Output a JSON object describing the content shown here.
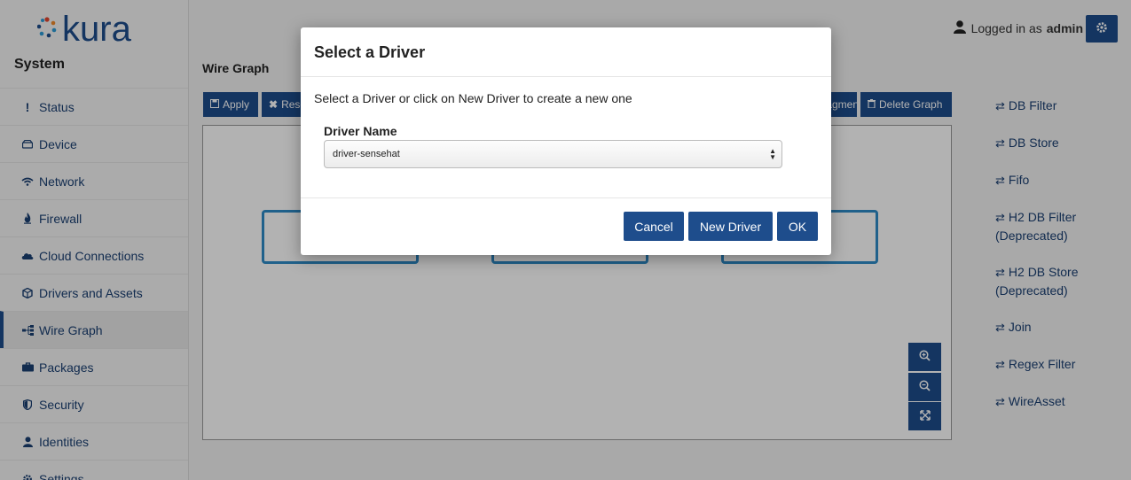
{
  "brand": {
    "logo_text": "kura"
  },
  "sidebar": {
    "section_title": "System",
    "items": [
      {
        "label": "Status",
        "icon": "exclamation-icon"
      },
      {
        "label": "Device",
        "icon": "hdd-icon"
      },
      {
        "label": "Network",
        "icon": "wifi-icon"
      },
      {
        "label": "Firewall",
        "icon": "fire-icon"
      },
      {
        "label": "Cloud Connections",
        "icon": "cloud-icon"
      },
      {
        "label": "Drivers and Assets",
        "icon": "cube-icon"
      },
      {
        "label": "Wire Graph",
        "icon": "sitemap-icon",
        "active": true
      },
      {
        "label": "Packages",
        "icon": "briefcase-icon"
      },
      {
        "label": "Security",
        "icon": "shield-icon"
      },
      {
        "label": "Identities",
        "icon": "user-icon"
      },
      {
        "label": "Settings",
        "icon": "gear-icon"
      }
    ]
  },
  "header": {
    "logged_in_prefix": "Logged in as",
    "username": "admin"
  },
  "main": {
    "title": "Wire Graph",
    "toolbar": {
      "apply": "Apply",
      "reset": "Reset",
      "fragment": "Fragment",
      "delete_graph": "Delete Graph"
    }
  },
  "components": [
    {
      "label": "DB Filter"
    },
    {
      "label": "DB Store"
    },
    {
      "label": "Fifo"
    },
    {
      "label": "H2 DB Filter",
      "sub": "(Deprecated)"
    },
    {
      "label": "H2 DB Store",
      "sub": "(Deprecated)"
    },
    {
      "label": "Join"
    },
    {
      "label": "Regex Filter"
    },
    {
      "label": "WireAsset"
    }
  ],
  "modal": {
    "title": "Select a Driver",
    "description": "Select a Driver or click on New Driver to create a new one",
    "field_label": "Driver Name",
    "selected_driver": "driver-sensehat",
    "buttons": {
      "cancel": "Cancel",
      "new_driver": "New Driver",
      "ok": "OK"
    }
  },
  "colors": {
    "primary": "#1e4d8c",
    "node_border": "#2e8cc7",
    "link": "#1b3f72"
  }
}
